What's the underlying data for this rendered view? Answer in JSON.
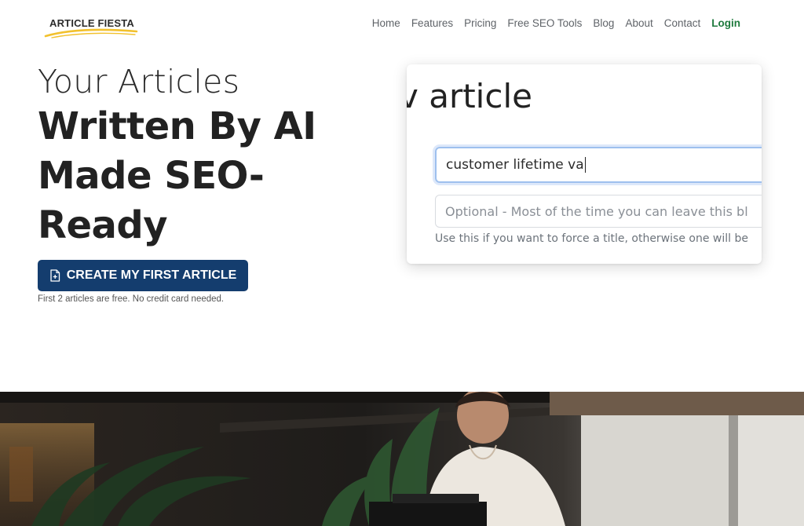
{
  "brand": {
    "name": "ARTICLE FIESTA",
    "swoosh_color": "#f2c12e"
  },
  "nav": {
    "items": [
      "Home",
      "Features",
      "Pricing",
      "Free SEO Tools",
      "Blog",
      "About",
      "Contact"
    ],
    "login": "Login"
  },
  "hero": {
    "subtitle": "Your Articles",
    "title": "Written By AI Made SEO-Ready",
    "cta_label": "CREATE MY FIRST ARTICLE",
    "cta_icon": "file-plus-icon",
    "cta_color": "#143d6e",
    "note": "First 2 articles are free. No credit card needed."
  },
  "demo": {
    "heading": "v article",
    "keyword_value": "customer lifetime va",
    "title_placeholder": "Optional - Most of the time you can leave this bl",
    "help_text": "Use this if you want to force a title, otherwise one will be"
  },
  "colors": {
    "login_green": "#1e7a3d",
    "focus_border": "#9ec0ee"
  }
}
